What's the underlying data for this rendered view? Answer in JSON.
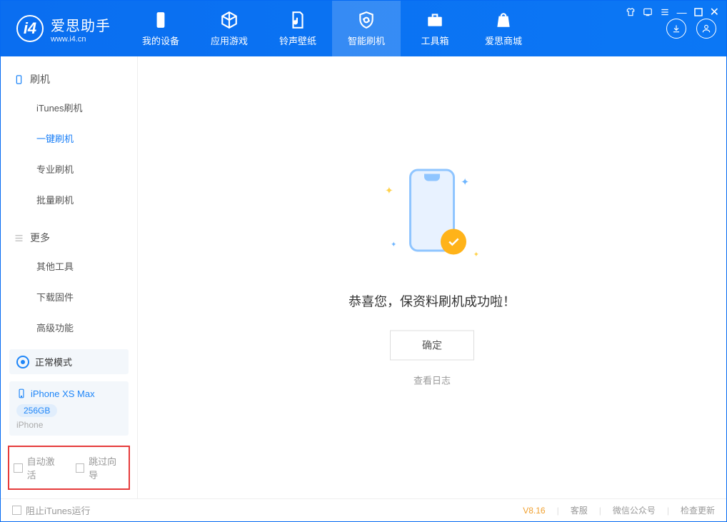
{
  "brand": {
    "name": "爱思助手",
    "url": "www.i4.cn"
  },
  "nav": {
    "tabs": [
      {
        "label": "我的设备"
      },
      {
        "label": "应用游戏"
      },
      {
        "label": "铃声壁纸"
      },
      {
        "label": "智能刷机"
      },
      {
        "label": "工具箱"
      },
      {
        "label": "爱思商城"
      }
    ]
  },
  "sidebar": {
    "group1": {
      "title": "刷机",
      "items": [
        {
          "label": "iTunes刷机"
        },
        {
          "label": "一键刷机"
        },
        {
          "label": "专业刷机"
        },
        {
          "label": "批量刷机"
        }
      ]
    },
    "group2": {
      "title": "更多",
      "items": [
        {
          "label": "其他工具"
        },
        {
          "label": "下载固件"
        },
        {
          "label": "高级功能"
        }
      ]
    },
    "status": {
      "mode": "正常模式"
    },
    "device": {
      "name": "iPhone XS Max",
      "storage": "256GB",
      "type": "iPhone"
    },
    "options": {
      "auto_activate": "自动激活",
      "skip_guide": "跳过向导"
    }
  },
  "main": {
    "message": "恭喜您，保资料刷机成功啦！",
    "ok_label": "确定",
    "log_link": "查看日志"
  },
  "footer": {
    "block_itunes": "阻止iTunes运行",
    "version": "V8.16",
    "links": [
      "客服",
      "微信公众号",
      "检查更新"
    ]
  }
}
